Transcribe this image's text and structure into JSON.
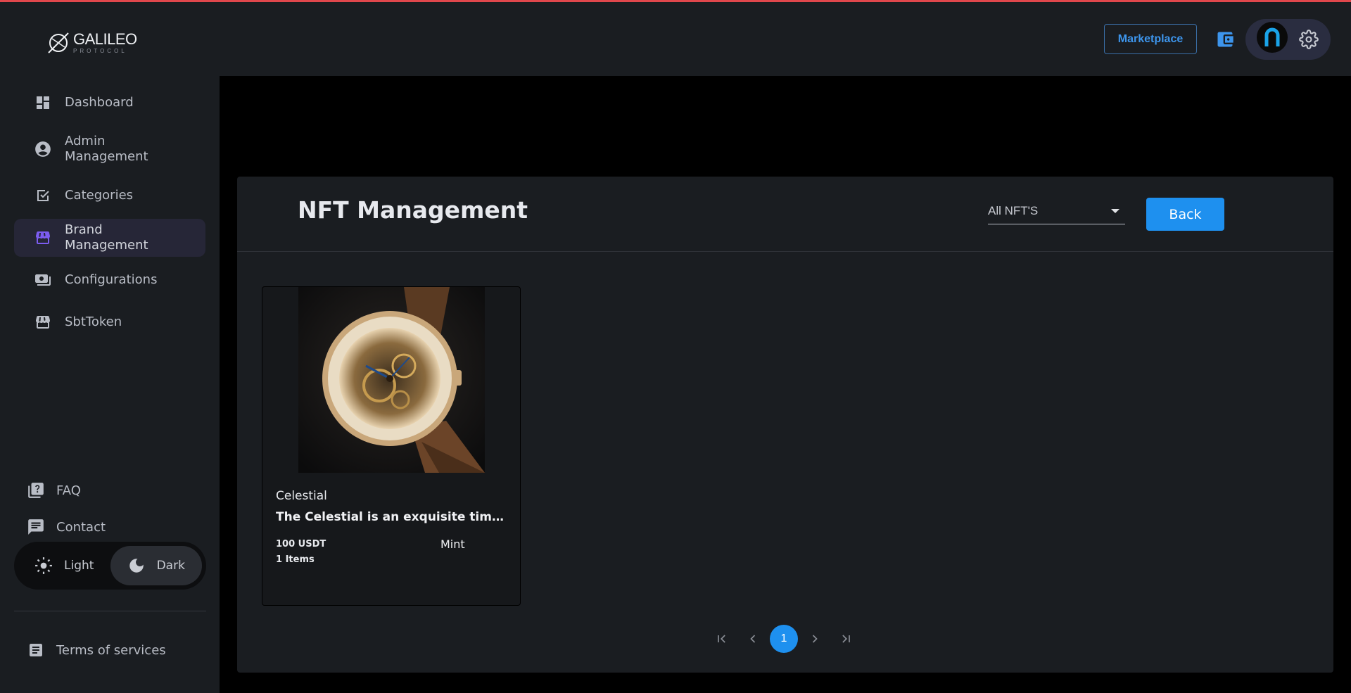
{
  "brand": {
    "name": "GALILEO",
    "sub": "PROTOCOL"
  },
  "sidebar": {
    "items": [
      {
        "label": "Dashboard",
        "icon": "dashboard-icon"
      },
      {
        "label": "Admin Management",
        "icon": "account-circle-icon"
      },
      {
        "label": "Categories",
        "icon": "checkbox-icon"
      },
      {
        "label": "Brand Management",
        "icon": "store-icon",
        "active": true
      },
      {
        "label": "Configurations",
        "icon": "payments-icon"
      },
      {
        "label": "SbtToken",
        "icon": "store-icon"
      }
    ],
    "bottom": [
      {
        "label": "FAQ",
        "icon": "quiz-icon"
      },
      {
        "label": "Contact",
        "icon": "chat-icon"
      }
    ],
    "theme": {
      "light": "Light",
      "dark": "Dark",
      "selected": "Dark"
    },
    "terms": "Terms of services"
  },
  "header": {
    "marketplace": "Marketplace"
  },
  "main": {
    "title": "NFT Management",
    "filter": {
      "value": "All NFT'S"
    },
    "back": "Back",
    "cards": [
      {
        "name": "Celestial",
        "description": "The Celestial is an exquisite timepiece crafted with precision",
        "price": "100 USDT",
        "items": "1 Items",
        "status": "Mint"
      }
    ],
    "pagination": {
      "current": "1"
    }
  },
  "colors": {
    "accent": "#1e90ef",
    "active_icon": "#7c5cf0",
    "panel": "#1a1d21",
    "background_main": "#000000"
  }
}
